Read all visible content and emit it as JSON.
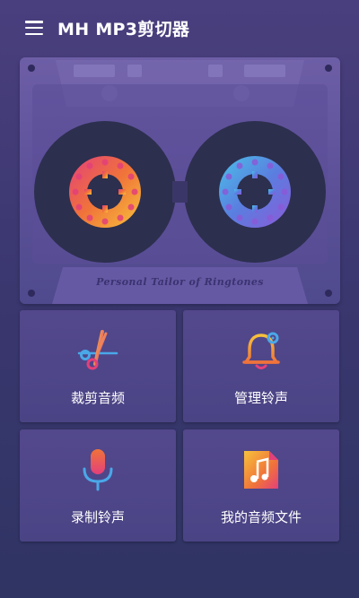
{
  "app_bar": {
    "title": "MH MP3剪切器",
    "menu_icon": "hamburger-menu-icon"
  },
  "banner": {
    "tagline": "Personal Tailor of Ringtones"
  },
  "tiles": [
    {
      "label": "裁剪音频",
      "icon": "scissors-icon"
    },
    {
      "label": "管理铃声",
      "icon": "bell-settings-icon"
    },
    {
      "label": "录制铃声",
      "icon": "microphone-icon"
    },
    {
      "label": "我的音频文件",
      "icon": "music-file-icon"
    }
  ],
  "colors": {
    "background_top": "#4a3f7e",
    "background_bottom": "#2f3463",
    "tile": "#4f4689",
    "reel_left_accent": "#f0733a",
    "reel_right_accent": "#4aa8e8"
  }
}
